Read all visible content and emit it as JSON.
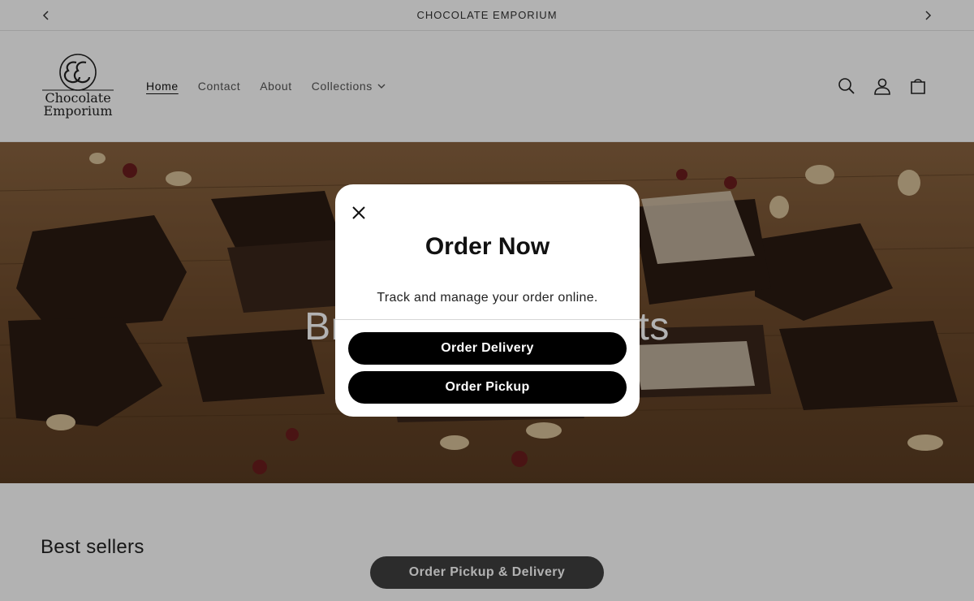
{
  "announcement": {
    "text": "CHOCOLATE EMPORIUM"
  },
  "logo": {
    "line1": "Chocolate",
    "line2": "Emporium"
  },
  "nav": {
    "items": [
      {
        "label": "Home",
        "active": true
      },
      {
        "label": "Contact"
      },
      {
        "label": "About"
      },
      {
        "label": "Collections",
        "has_dropdown": true
      }
    ]
  },
  "header_icons": [
    "search-icon",
    "account-icon",
    "cart-icon"
  ],
  "hero": {
    "heading": "Browse our products"
  },
  "best_sellers": {
    "heading": "Best sellers"
  },
  "floating_button": {
    "label": "Order Pickup & Delivery"
  },
  "modal": {
    "title": "Order Now",
    "subtitle": "Track and manage your order online.",
    "buttons": [
      "Order Delivery",
      "Order Pickup"
    ]
  },
  "colors": {
    "button_bg": "#000000",
    "overlay": "rgba(0,0,0,0.30)",
    "hero_wood": "#7a5a3b"
  }
}
